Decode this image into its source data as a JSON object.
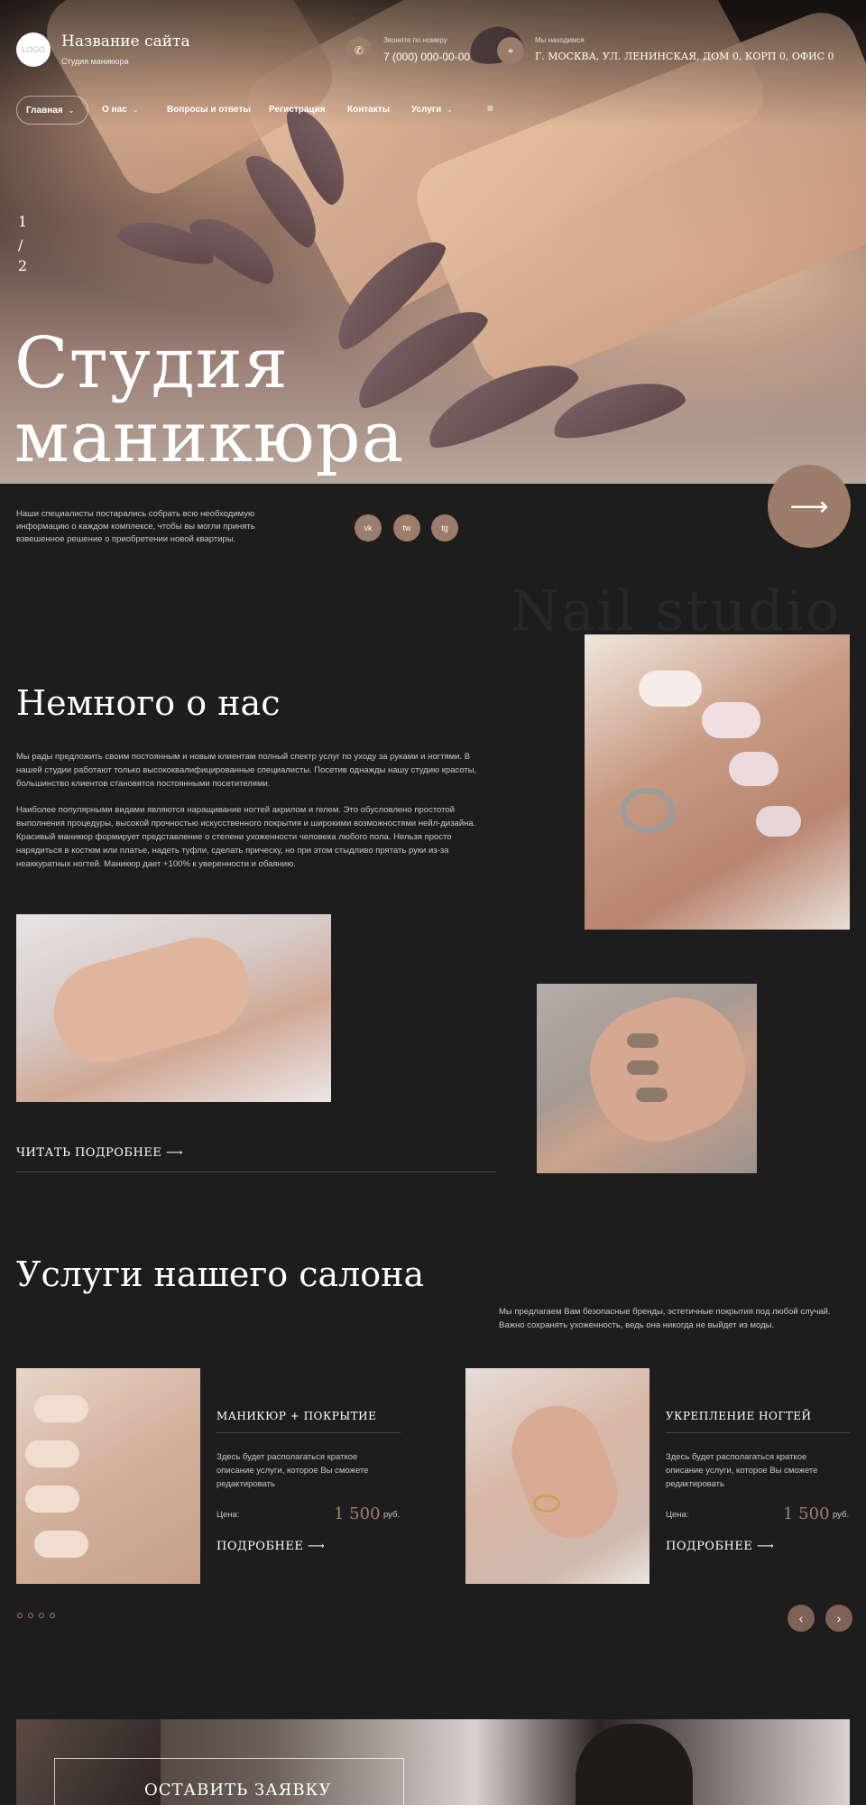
{
  "header": {
    "logo_text": "LOGO",
    "site_title": "Название сайта",
    "site_subtitle": "Студия маникюра",
    "phone_label": "Звоните по номеру",
    "phone_value": "7 (000) 000-00-00",
    "address_label": "Мы находимся",
    "address_value": "Г. МОСКВА, УЛ. ЛЕНИНСКАЯ, ДОМ 0, КОРП 0, ОФИС 0",
    "phone_icon": "phone-icon",
    "location_icon": "location-icon"
  },
  "nav": {
    "items": [
      {
        "label": "Главная"
      },
      {
        "label": "О нас"
      },
      {
        "label": "Вопросы и ответы"
      },
      {
        "label": "Регистрация"
      },
      {
        "label": "Контакты"
      },
      {
        "label": "Услуги"
      }
    ],
    "menu_icon": "≡"
  },
  "hero": {
    "page_current": "1",
    "page_sep": "/",
    "page_total": "2",
    "title_line1": "Студия",
    "title_line2": "маникюра",
    "next_arrow": "⟶"
  },
  "intro": {
    "text": "Наши специалисты постарались собрать всю необходимую информацию о каждом комплексе, чтобы вы могли принять взвешенное решение о приобретении новой квартиры.",
    "social": [
      "vk",
      "tw",
      "tg"
    ]
  },
  "about": {
    "watermark": "Nail studio",
    "title": "Немного о нас",
    "para1": "Мы рады предложить своим постоянным и новым клиентам полный спектр услуг по уходу за руками и ногтями. В нашей студии работают только высококвалифицированные специалисты. Посетив однажды нашу студию красоты, большинство клиентов становятся постоянными посетителями.",
    "para2": "Наиболее популярными видами являются наращивание ногтей акрилом и гелем. Это обусловлено простотой выполнения процедуры, высокой прочностью искусственного покрытия и широкими возможностями нейл-дизайна. Красивый маникюр формирует представление о степени ухоженности человека любого пола. Нельзя просто нарядиться в костюм или платье, надеть туфли, сделать прическу, но при этом стыдливо прятать руки из-за неаккуратных ногтей. Маникюр дает +100% к уверенности и обаянию.",
    "read_more": "ЧИТАТЬ ПОДРОБНЕЕ"
  },
  "services": {
    "title": "Услуги нашего салона",
    "desc": "Мы предлагаем Вам безопасные бренды, эстетичные покрытия под любой случай. Важно сохранять ухоженность, ведь она никогда не выйдет из моды.",
    "cards": [
      {
        "title": "МАНИКЮР + ПОКРЫТИЕ",
        "desc": "Здесь будет располагаться краткое описание услуги, которое Вы сможете редактировать",
        "price_label": "Цена:",
        "price": "1 500",
        "unit": "руб.",
        "more": "ПОДРОБНЕЕ"
      },
      {
        "title": "УКРЕПЛЕНИЕ НОГТЕЙ",
        "desc": "Здесь будет располагаться краткое описание услуги, которое Вы сможете редактировать",
        "price_label": "Цена:",
        "price": "1 500",
        "unit": "руб.",
        "more": "ПОДРОБНЕЕ"
      }
    ],
    "prev_arrow": "‹",
    "next_arrow": "›"
  },
  "cta": {
    "label": "ОСТАВИТЬ ЗАЯВКУ"
  },
  "colors": {
    "accent": "#9c7d6b",
    "background": "#1d1d1d",
    "price": "#a0806e"
  }
}
